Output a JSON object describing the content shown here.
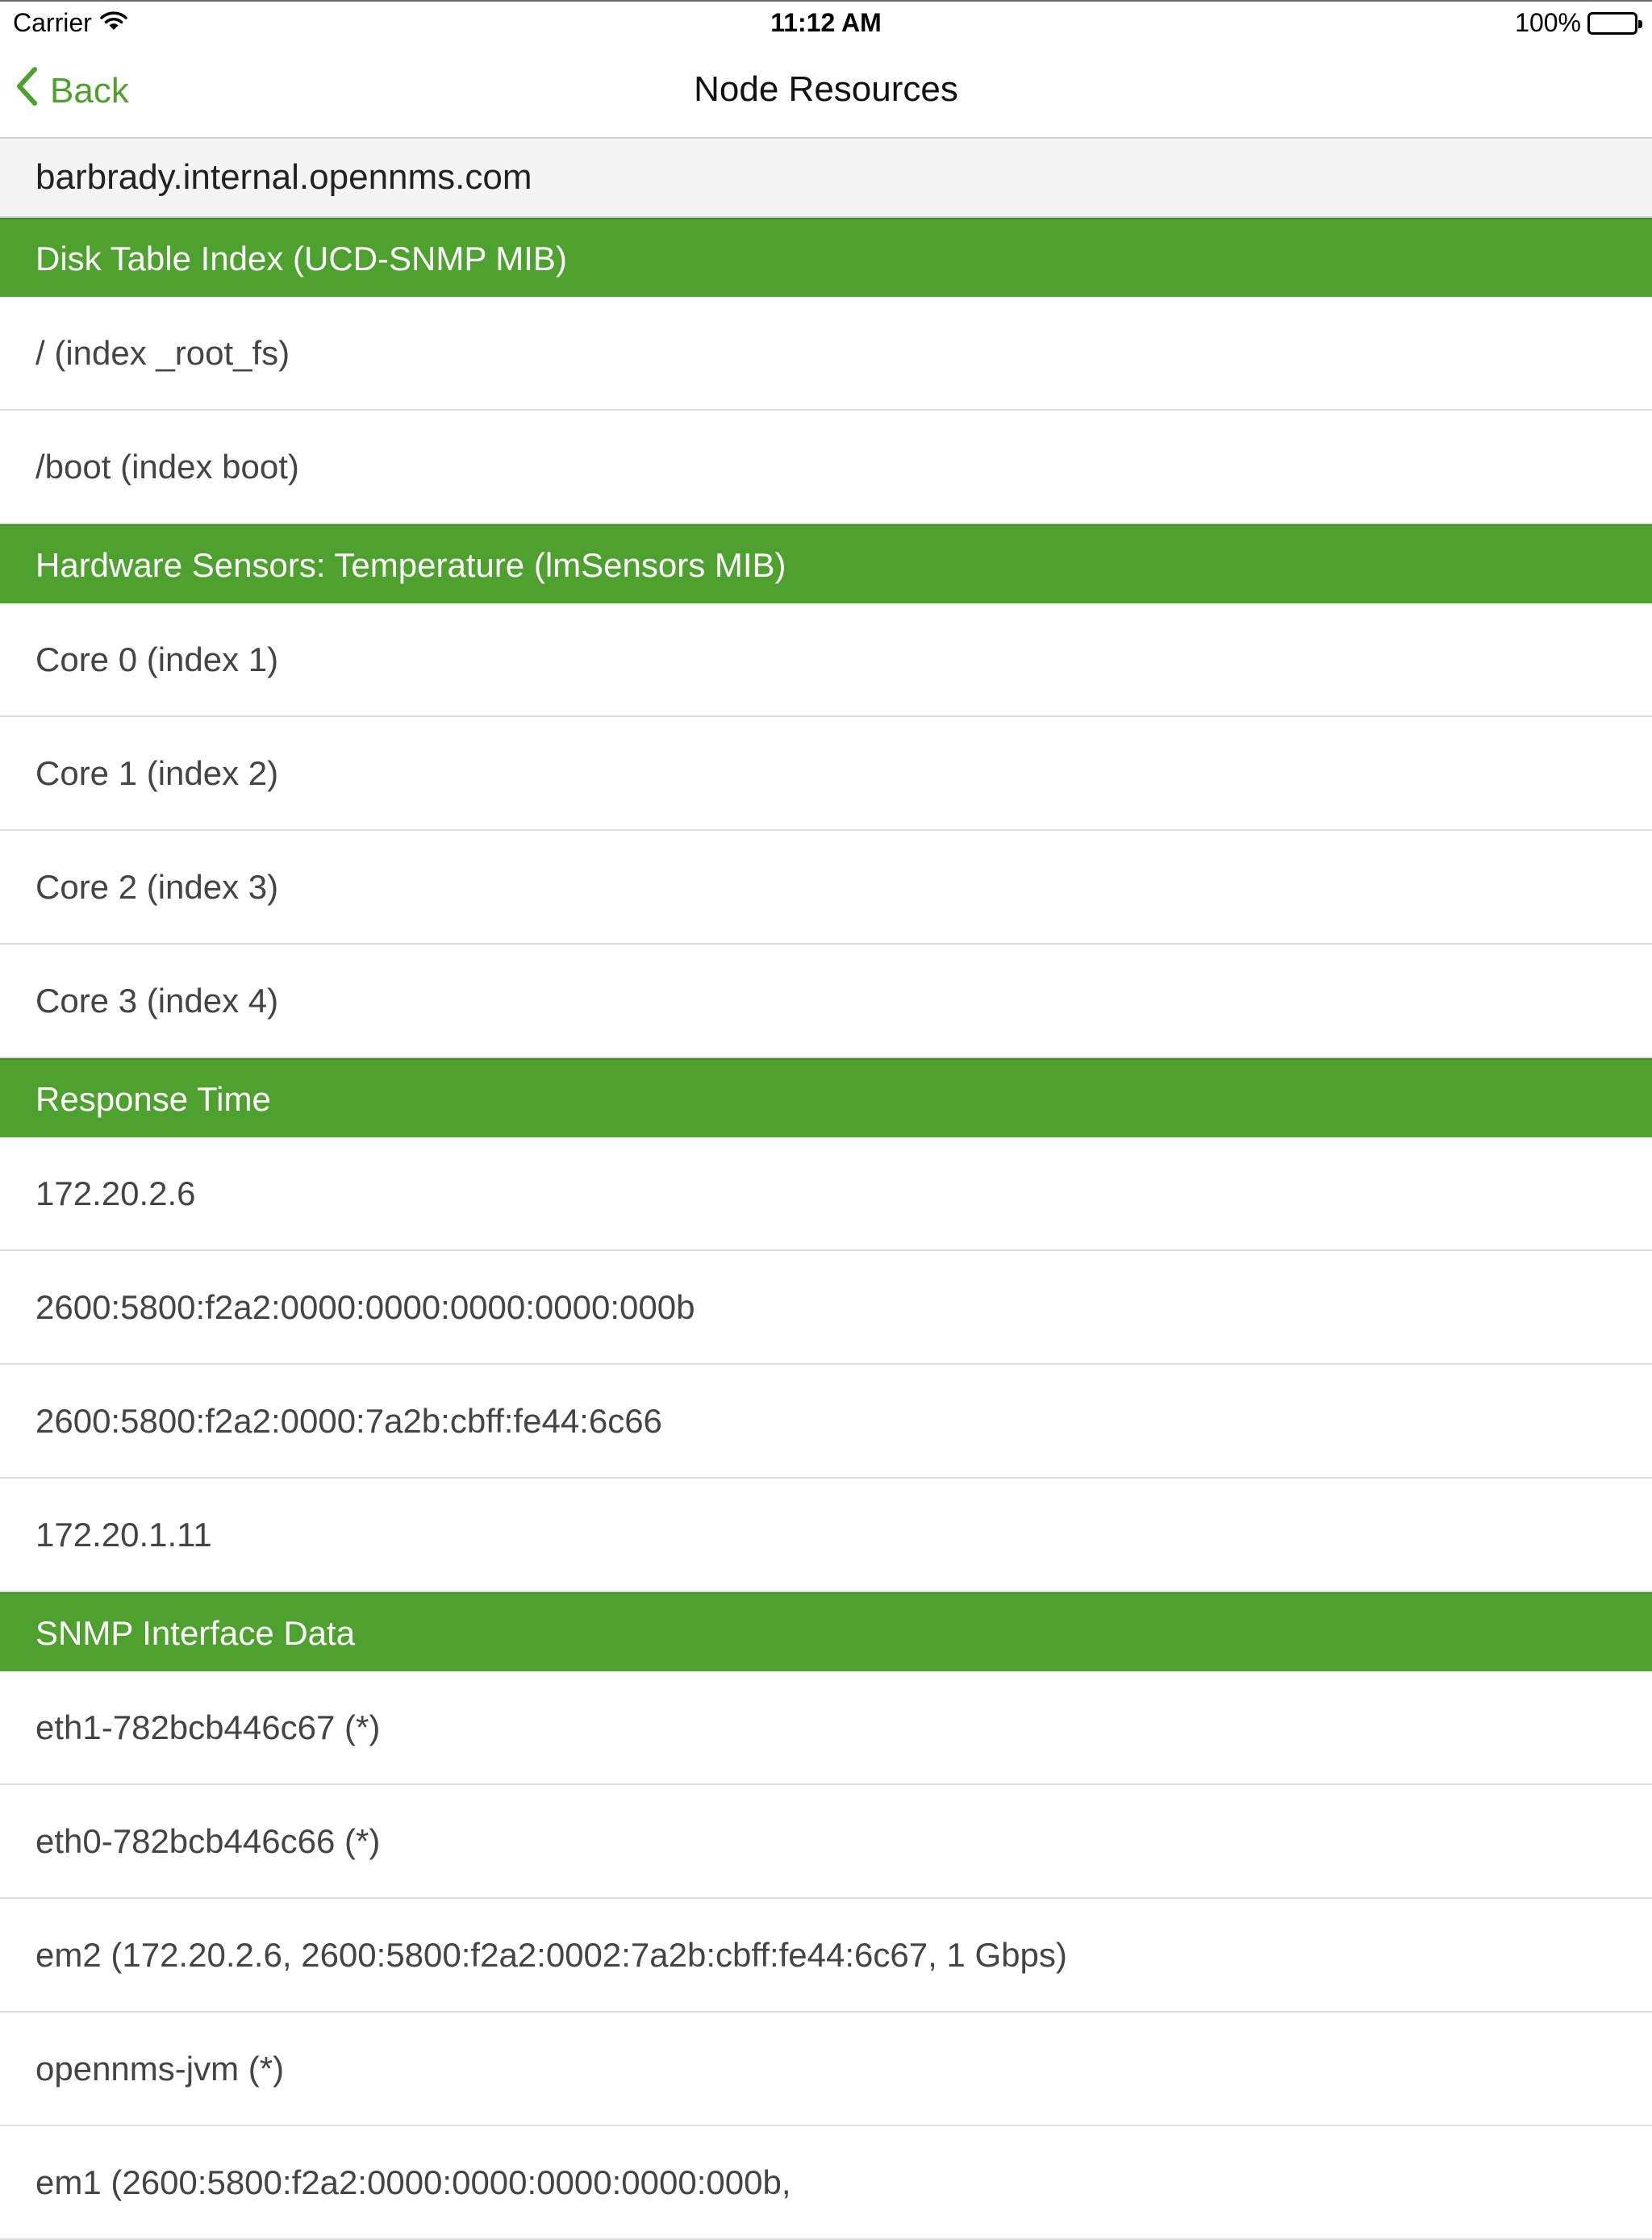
{
  "status_bar": {
    "carrier": "Carrier",
    "time": "11:12 AM",
    "battery": "100%"
  },
  "nav": {
    "back_label": "Back",
    "title": "Node Resources"
  },
  "node": {
    "name": "barbrady.internal.opennms.com"
  },
  "colors": {
    "accent": "#4fa12f"
  },
  "sections": [
    {
      "title": "Disk Table Index (UCD-SNMP MIB)",
      "items": [
        "/ (index _root_fs)",
        "/boot (index boot)"
      ]
    },
    {
      "title": "Hardware Sensors: Temperature (lmSensors MIB)",
      "items": [
        "Core 0 (index 1)",
        "Core 1 (index 2)",
        "Core 2 (index 3)",
        "Core 3 (index 4)"
      ]
    },
    {
      "title": "Response Time",
      "items": [
        "172.20.2.6",
        "2600:5800:f2a2:0000:0000:0000:0000:000b",
        "2600:5800:f2a2:0000:7a2b:cbff:fe44:6c66",
        "172.20.1.11"
      ]
    },
    {
      "title": "SNMP Interface Data",
      "items": [
        "eth1-782bcb446c67 (*)",
        "eth0-782bcb446c66 (*)",
        "em2 (172.20.2.6, 2600:5800:f2a2:0002:7a2b:cbff:fe44:6c67, 1 Gbps)",
        "opennms-jvm (*)",
        "em1 (2600:5800:f2a2:0000:0000:0000:0000:000b,"
      ]
    }
  ]
}
